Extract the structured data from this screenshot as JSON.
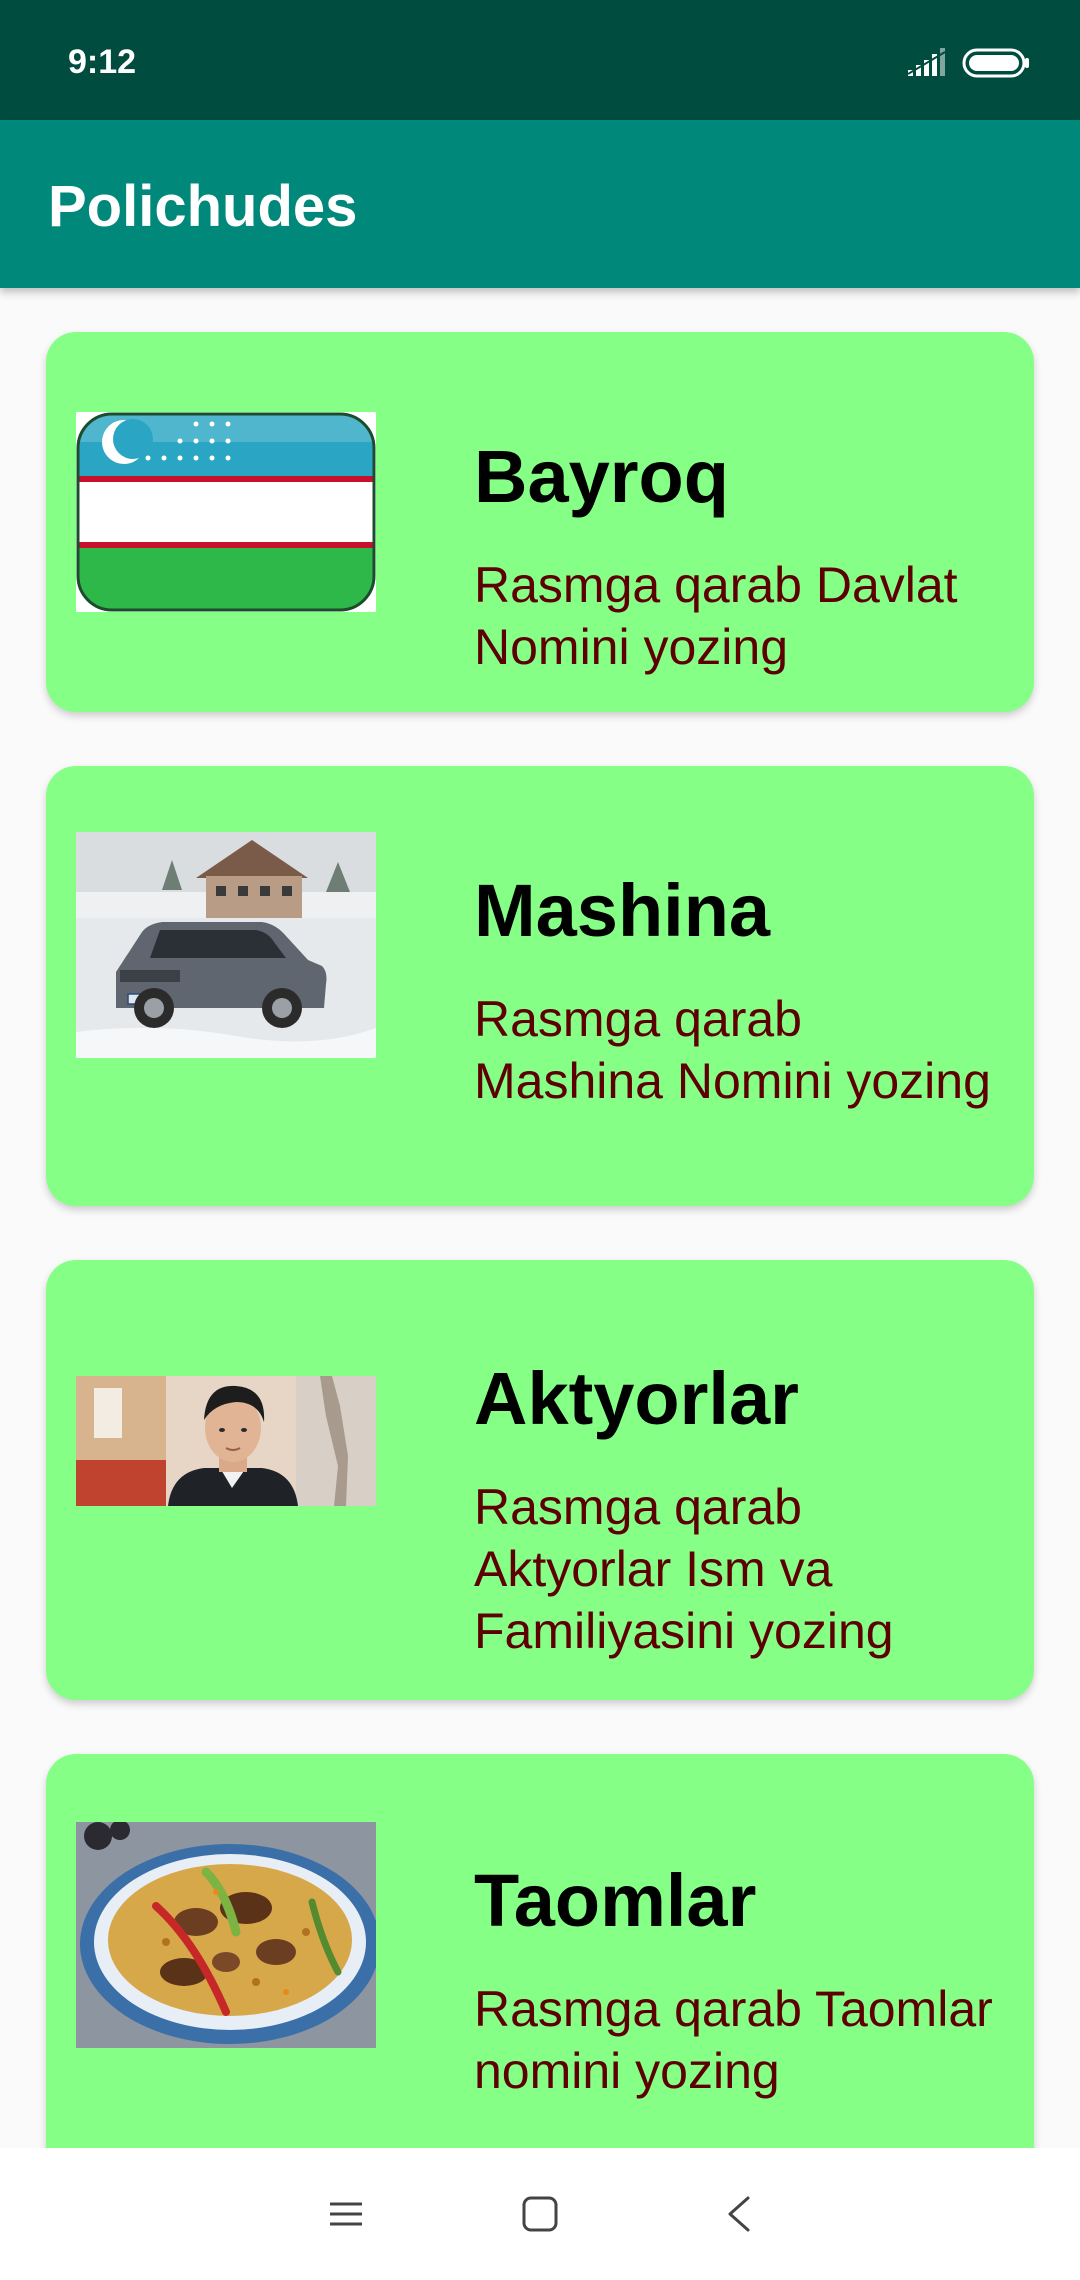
{
  "status_bar": {
    "time": "9:12",
    "signal_icon": "signal-icon",
    "battery_icon": "battery-icon"
  },
  "app_bar": {
    "title": "Polichudes"
  },
  "cards": [
    {
      "title": "Bayroq",
      "description": "Rasmga qarab Davlat Nomini yozing",
      "image": "uzbekistan-flag-image"
    },
    {
      "title": "Mashina",
      "description": "Rasmga qarab Mashina Nomini yozing",
      "image": "car-in-snow-image"
    },
    {
      "title": "Aktyorlar",
      "description": "Rasmga qarab Aktyorlar Ism va Familiyasini yozing",
      "image": "actor-portrait-image"
    },
    {
      "title": "Taomlar",
      "description": "Rasmga qarab Taomlar nomini yozing",
      "image": "plov-dish-image"
    }
  ],
  "nav_bar": {
    "menu_icon": "menu-icon",
    "home_icon": "home-icon",
    "back_icon": "back-icon"
  },
  "colors": {
    "status_bar": "#004d40",
    "app_bar": "#00897b",
    "card_background": "#86ff86",
    "title_text": "#000000",
    "description_text": "#5d0000"
  }
}
